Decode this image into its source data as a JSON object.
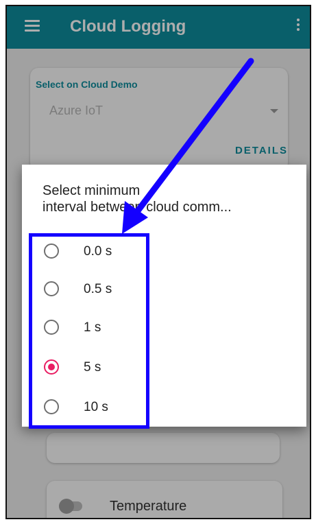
{
  "appbar": {
    "title": "Cloud Logging",
    "menu_icon": "hamburger-menu-icon",
    "more_icon": "more-vert-icon",
    "color": "#0e8d9c"
  },
  "cloud_select": {
    "label": "Select on Cloud Demo",
    "value": "Azure IoT",
    "details_label": "DETAILS"
  },
  "sensor_card": {
    "label": "Temperature",
    "enabled": false
  },
  "dialog": {
    "title_line1": "Select minimum",
    "title_line2": "interval between cloud comm...",
    "options": [
      {
        "label": "0.0 s",
        "selected": false
      },
      {
        "label": "0.5 s",
        "selected": false
      },
      {
        "label": "1 s",
        "selected": false
      },
      {
        "label": "5 s",
        "selected": true
      },
      {
        "label": "10 s",
        "selected": false
      }
    ],
    "accent": "#e91e63"
  },
  "annotation": {
    "color": "#1400ff"
  }
}
